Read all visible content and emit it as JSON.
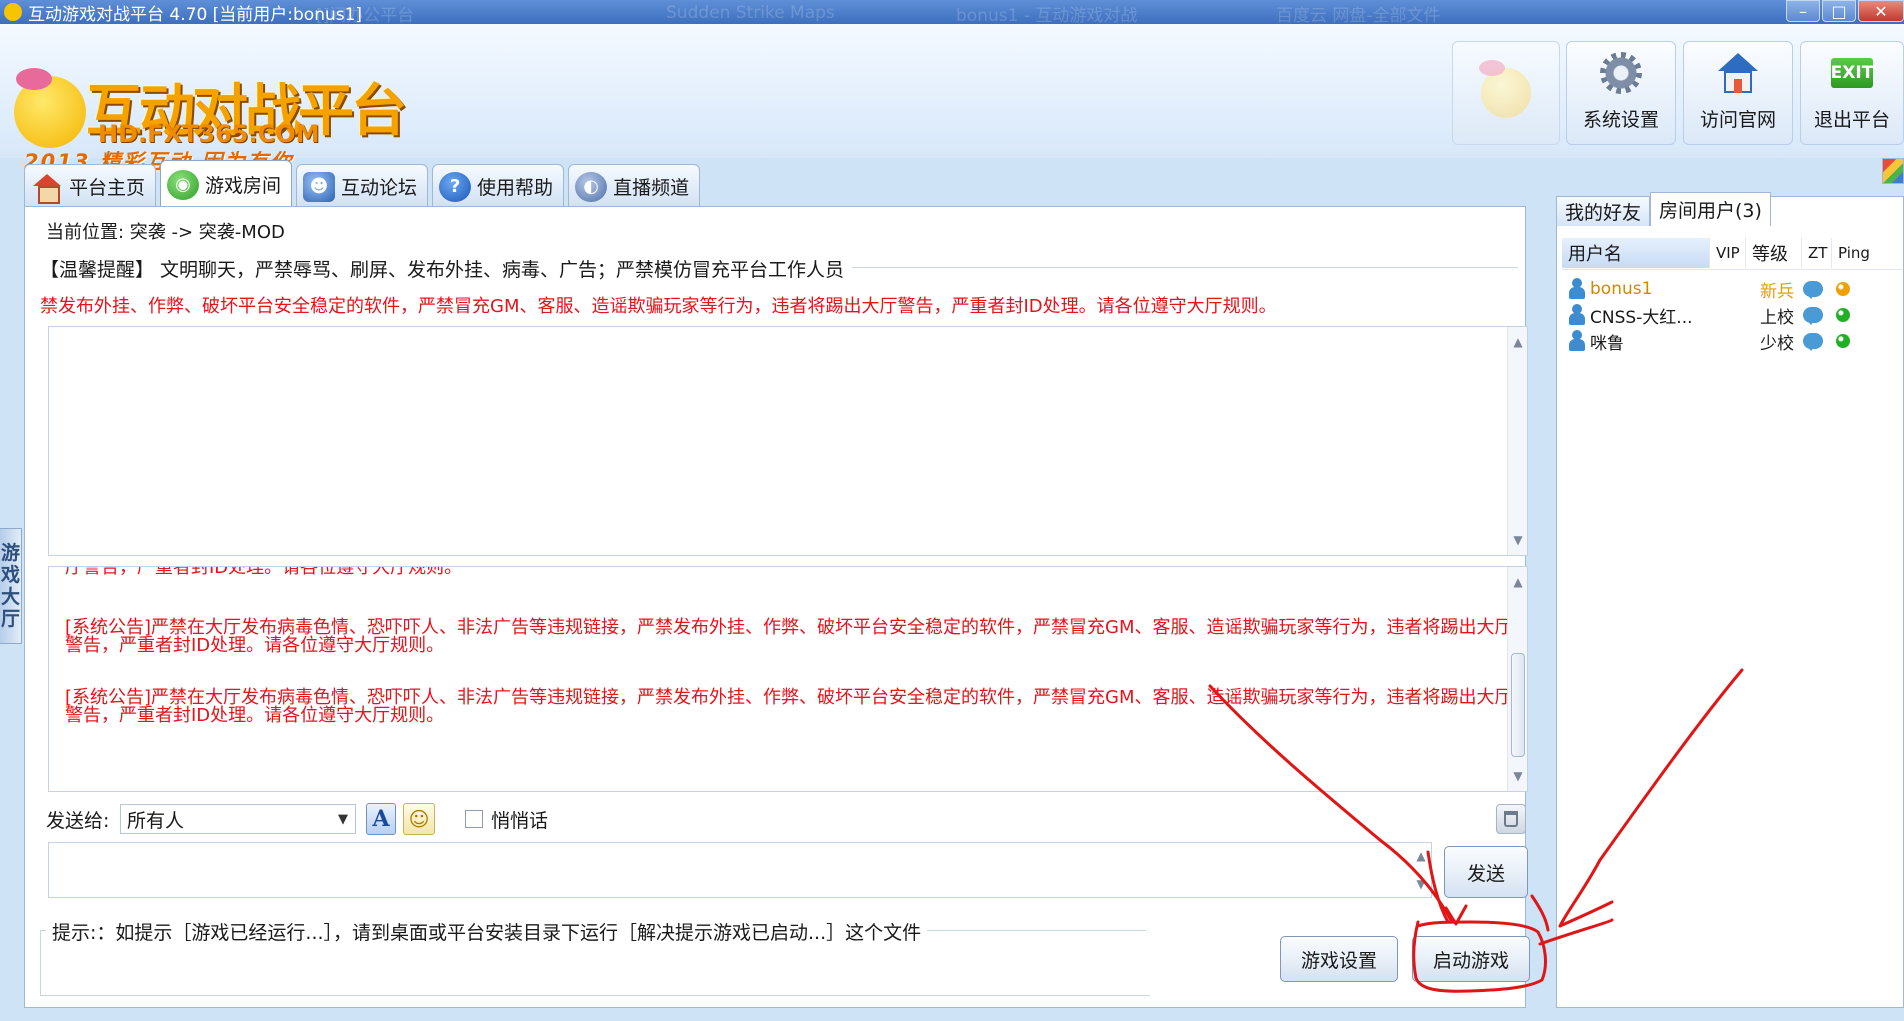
{
  "window": {
    "title": "互动游戏对战平台 4.70 [当前用户:bonus1]",
    "ghost_tabs": [
      "[]间办公平台",
      "Sudden Strike Maps",
      "bonus1 - 互动游戏对战",
      "百度云 网盘-全部文件"
    ]
  },
  "header": {
    "logo_cn": "互动对战平台",
    "logo_url": "HD.FXT365.COM",
    "logo_slogan": "2013 精彩互动 因为有你",
    "buttons": [
      {
        "label": "系统设置",
        "icon": "gear-icon"
      },
      {
        "label": "访问官网",
        "icon": "house-icon"
      },
      {
        "label": "退出平台",
        "icon": "exit-icon",
        "icon_text": "EXIT"
      }
    ]
  },
  "tabs": [
    {
      "label": "平台主页",
      "icon": "home-icon"
    },
    {
      "label": "游戏房间",
      "icon": "gamepad-icon",
      "active": true
    },
    {
      "label": "互动论坛",
      "icon": "forum-icon"
    },
    {
      "label": "使用帮助",
      "icon": "help-icon",
      "glyph": "?"
    },
    {
      "label": "直播频道",
      "icon": "live-icon"
    }
  ],
  "side_strip": "游戏大厅",
  "room": {
    "location": "当前位置: 突袭 -> 突袭-MOD",
    "tip": "【温馨提醒】 文明聊天，严禁辱骂、刷屏、发布外挂、病毒、广告；严禁模仿冒充平台工作人员",
    "warning": "禁发布外挂、作弊、破坏平台安全稳定的软件，严禁冒充GM、客服、造谣欺骗玩家等行为，违者将踢出大厅警告，严重者封ID处理。请各位遵守大厅规则。",
    "messages": [
      "厅警告，严重者封ID处理。请各位遵守大厅规则。",
      "[系统公告]严禁在大厅发布病毒色情、恐吓吓人、非法广告等违规链接，严禁发布外挂、作弊、破坏平台安全稳定的软件，严禁冒充GM、客服、造谣欺骗玩家等行为，违者将踢出大厅警告，严重者封ID处理。请各位遵守大厅规则。",
      "[系统公告]严禁在大厅发布病毒色情、恐吓吓人、非法广告等违规链接，严禁发布外挂、作弊、破坏平台安全稳定的软件，严禁冒充GM、客服、造谣欺骗玩家等行为，违者将踢出大厅警告，严重者封ID处理。请各位遵守大厅规则。"
    ],
    "send_to_label": "发送给:",
    "send_to_value": "所有人",
    "font_glyph": "A",
    "emoji_glyph": "☺",
    "whisper_label": "悄悄话",
    "send_button": "发送",
    "hint": "提示:：如提示［游戏已经运行...］，请到桌面或平台安装目录下运行［解决提示游戏已启动...］这个文件",
    "game_settings_button": "游戏设置",
    "start_game_button": "启动游戏"
  },
  "right_panel": {
    "tabs": [
      "我的好友",
      "房间用户(3)"
    ],
    "columns": [
      "用户名",
      "VIP",
      "等级",
      "ZT",
      "Ping"
    ],
    "users": [
      {
        "name": "bonus1",
        "level": "新兵",
        "name_color": "#d08a00",
        "level_color": "#e0a000",
        "ping_color": "#f0a000"
      },
      {
        "name": "CNSS-大红...",
        "level": "上校",
        "name_color": "#1a1a1a",
        "level_color": "#1a1a1a",
        "ping_color": "#21b024"
      },
      {
        "name": "咪鲁",
        "level": "少校",
        "name_color": "#1a1a1a",
        "level_color": "#1a1a1a",
        "ping_color": "#21b024"
      }
    ]
  },
  "colors": {
    "warning_red": "#e8121a",
    "annotation_red": "#e01515"
  }
}
